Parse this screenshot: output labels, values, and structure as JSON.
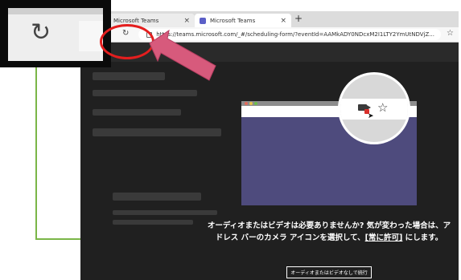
{
  "browser": {
    "tabs": [
      {
        "label": "Microsoft Teams",
        "active": false
      },
      {
        "label": "Microsoft Teams",
        "active": true
      }
    ],
    "address": "https://teams.microsoft.com/_#/scheduling-form/?eventId=AAMkADY0NDcxM2I1LTY2YmUtNDVjZ..."
  },
  "zoom": {
    "icon": "refresh-icon"
  },
  "dialog": {
    "message_line1": "オーディオまたはビデオは必要ありませんか? 気が変わった場合は、ア",
    "message_line2_a": "ドレス バーのカメラ アイコンを選択して、",
    "message_line2_link": "[常に許可]",
    "message_line2_b": " にします。",
    "continue_button": "オーディオまたはビデオなしで続行"
  },
  "colors": {
    "accent_red": "#e41e1e",
    "arrow_pink": "#d75a7c",
    "illustration_purple": "#4e4b7d",
    "guide_green": "#7ab648"
  }
}
